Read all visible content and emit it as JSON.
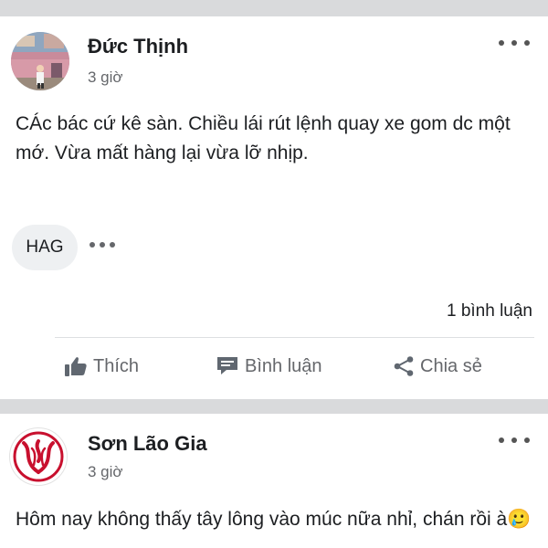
{
  "posts": [
    {
      "author": "Đức Thịnh",
      "time": "3 giờ",
      "text": "CÁc bác cứ kê sàn. Chiều lái rút lệnh quay xe gom dc một mớ. Vừa mất hàng lại vừa lỡ nhịp.",
      "tag": "HAG",
      "comments": "1 bình luận",
      "actions": {
        "like": "Thích",
        "comment": "Bình luận",
        "share": "Chia sẻ"
      }
    },
    {
      "author": "Sơn Lão Gia",
      "time": "3 giờ",
      "text": "Hôm nay không thấy tây lông vào múc nữa nhỉ, chán rồi à🥲"
    }
  ],
  "icons": {
    "like": "thumbs-up-icon",
    "comment": "comment-icon",
    "share": "share-icon",
    "more": "more-horizontal-icon"
  },
  "colors": {
    "divider": "#d9dadc",
    "muted_text": "#65676b",
    "logo_red": "#c8102e"
  }
}
